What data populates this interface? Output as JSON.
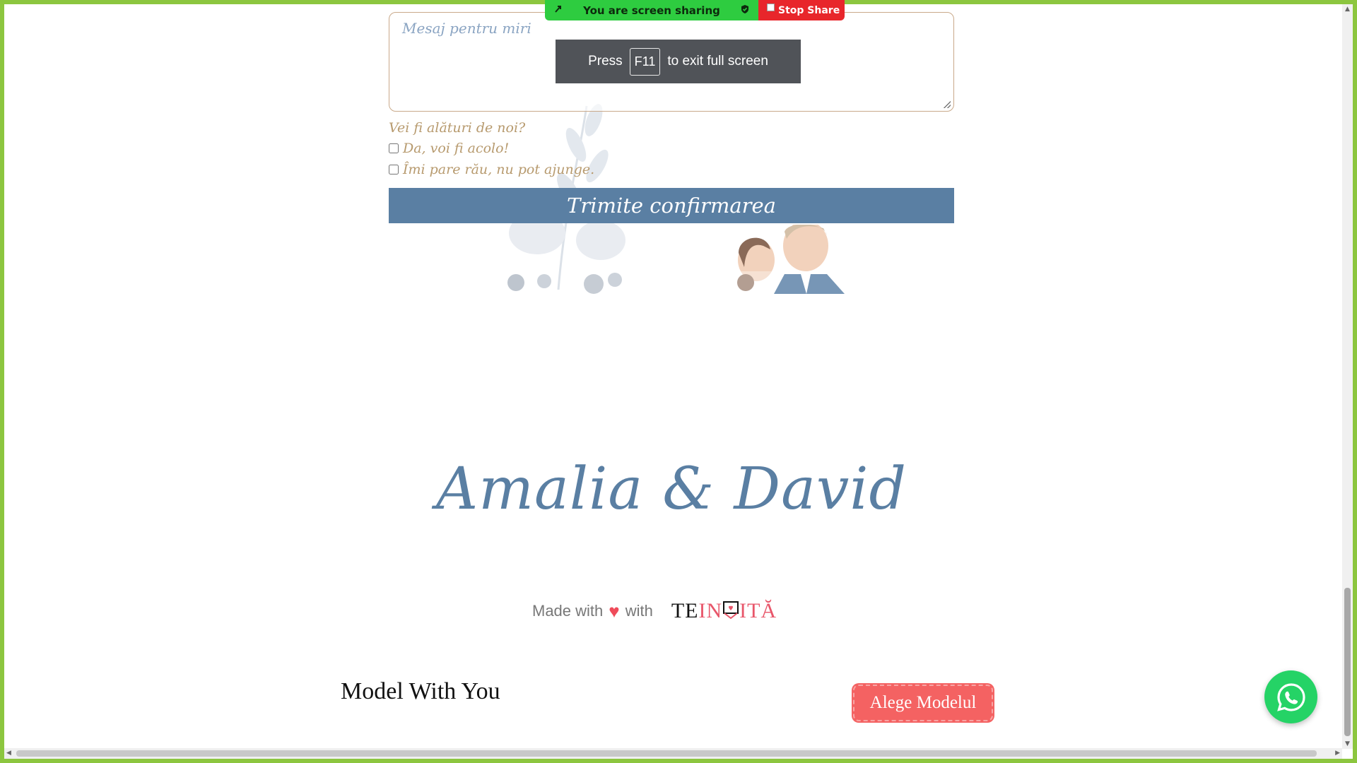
{
  "screen_share": {
    "status_text": "You are screen sharing",
    "stop_label": "Stop Share"
  },
  "fullscreen_toast": {
    "prefix": "Press",
    "key": "F11",
    "suffix": "to exit full screen"
  },
  "rsvp": {
    "message_placeholder": "Mesaj pentru miri",
    "question": "Vei fi alături de noi?",
    "option_yes": "Da, voi fi acolo!",
    "option_no": "Îmi pare rău, nu pot ajunge.",
    "submit_label": "Trimite confirmarea"
  },
  "couple_names": "Amalia & David",
  "footer": {
    "made_with": "Made with",
    "with": "with",
    "logo_part1": "TE",
    "logo_part2": "IN",
    "logo_part3": "ITĂ"
  },
  "model_section": {
    "title": "Model With You",
    "choose_button": "Alege Modelul"
  },
  "colors": {
    "accent_blue": "#5a7fa3",
    "gold_text": "#b79a6e",
    "choose_red": "#f46262",
    "whatsapp_green": "#25d366",
    "share_green": "#2ecc40",
    "frame_green": "#8cc63f"
  }
}
